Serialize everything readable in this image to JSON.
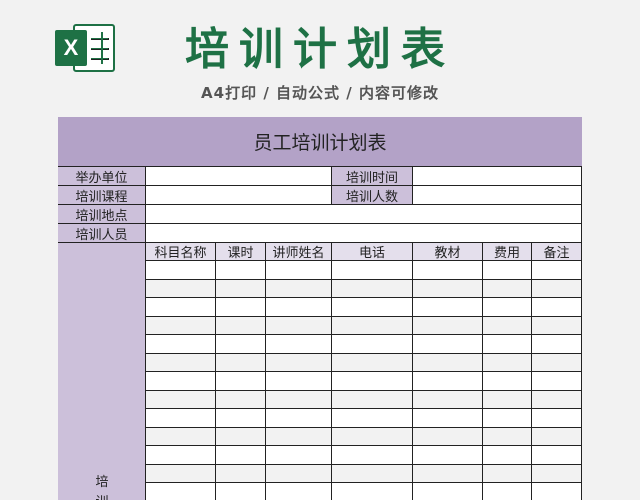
{
  "header": {
    "icon_letter": "X",
    "title": "培训计划表",
    "subtitle": "A4打印 / 自动公式 / 内容可修改"
  },
  "sheet": {
    "title": "员工培训计划表",
    "info": {
      "organizer_label": "举办单位",
      "time_label": "培训时间",
      "course_label": "培训课程",
      "count_label": "培训人数",
      "location_label": "培训地点",
      "staff_label": "培训人员"
    },
    "columns": [
      "科目名称",
      "课时",
      "讲师姓名",
      "电话",
      "教材",
      "费用",
      "备注"
    ],
    "side_label_chars": [
      "培",
      "训"
    ],
    "empty_rows": 13
  },
  "colors": {
    "brand_green": "#1e7145",
    "title_purple": "#b3a2c7",
    "label_purple": "#ccc0da",
    "header_purple": "#e4dfec"
  }
}
